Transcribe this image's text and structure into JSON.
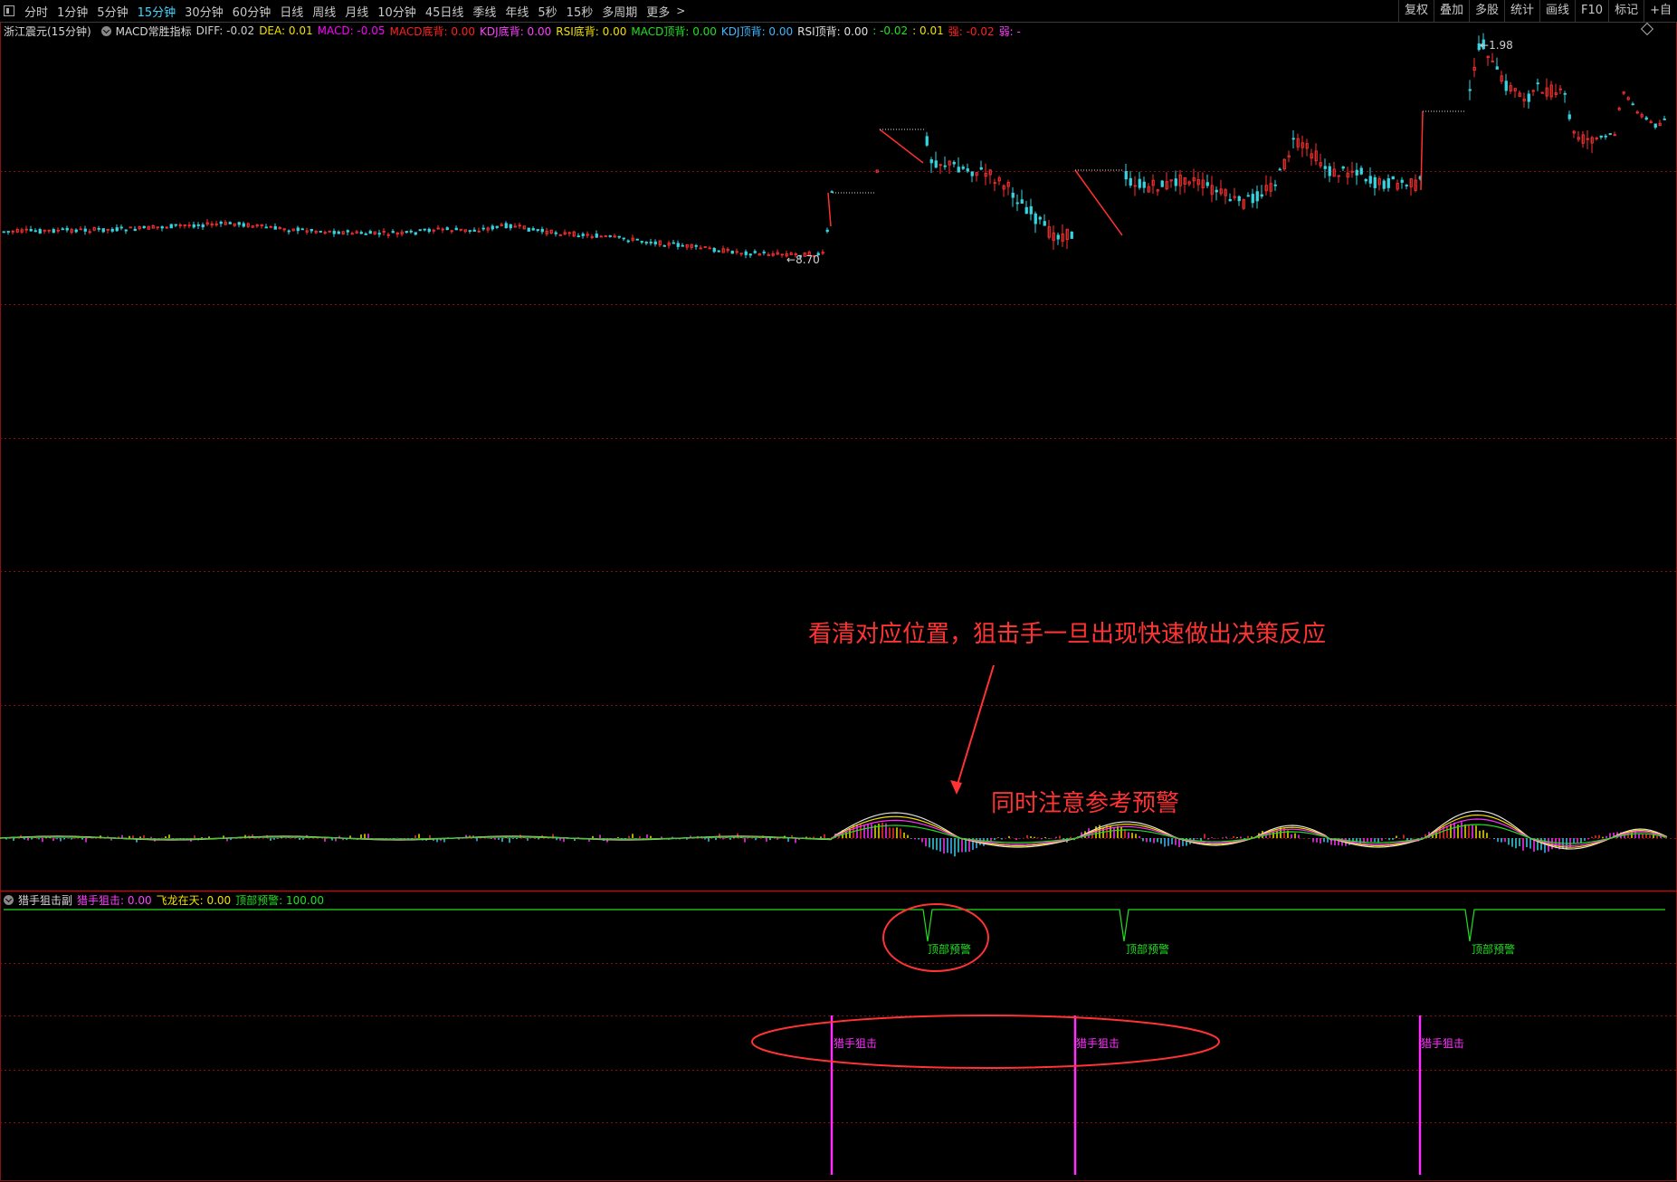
{
  "toolbar": {
    "periods": [
      "分时",
      "1分钟",
      "5分钟",
      "15分钟",
      "30分钟",
      "60分钟",
      "日线",
      "周线",
      "月线",
      "10分钟",
      "45日线",
      "季线",
      "年线",
      "5秒",
      "15秒",
      "多周期",
      "更多"
    ],
    "active_period": "15分钟",
    "right_buttons": [
      "复权",
      "叠加",
      "多股",
      "统计",
      "画线",
      "F10",
      "标记",
      "+自"
    ]
  },
  "main_info": {
    "stock": "浙江震元(15分钟)",
    "indicator": "MACD常胜指标",
    "fields": [
      {
        "label": "DIFF: -0.02",
        "color": "#d0d0d0"
      },
      {
        "label": "DEA: 0.01",
        "color": "#f0e000"
      },
      {
        "label": "MACD: -0.05",
        "color": "#ff00ff"
      },
      {
        "label": "MACD底背: 0.00",
        "color": "#ff2020"
      },
      {
        "label": "KDJ底背: 0.00",
        "color": "#ff40ff"
      },
      {
        "label": "RSI底背: 0.00",
        "color": "#f0e000"
      },
      {
        "label": "MACD顶背: 0.00",
        "color": "#20e020"
      },
      {
        "label": "KDJ顶背: 0.00",
        "color": "#3fb8ff"
      },
      {
        "label": "RSI顶背: 0.00",
        "color": "#e0e0e0"
      },
      {
        "label": ": -0.02",
        "color": "#20e020"
      },
      {
        "label": ": 0.01",
        "color": "#f0e000"
      },
      {
        "label": "强: -0.02",
        "color": "#ff2020"
      },
      {
        "label": "弱: -",
        "color": "#ff40ff"
      }
    ]
  },
  "price_labels": {
    "high": "1.98",
    "low": "8.70"
  },
  "annotations": {
    "main": "看清对应位置，狙击手一旦出现快速做出决策反应",
    "warning": "同时注意参考预警"
  },
  "sub_info": {
    "title": "猎手狙击副",
    "fields": [
      {
        "label": "猎手狙击: 0.00",
        "color": "#ff40ff"
      },
      {
        "label": "飞龙在天: 0.00",
        "color": "#f0e000"
      },
      {
        "label": "顶部预警: 100.00",
        "color": "#20e020"
      }
    ]
  },
  "signals": {
    "top_warning_label": "顶部预警",
    "sniper_label": "猎手狙击"
  },
  "colors": {
    "up": "#ff3030",
    "down": "#36d3e0",
    "grid": "#8a1010",
    "sniper": "#ff30ff",
    "warning": "#20e020",
    "annotation": "#ff3333"
  }
}
